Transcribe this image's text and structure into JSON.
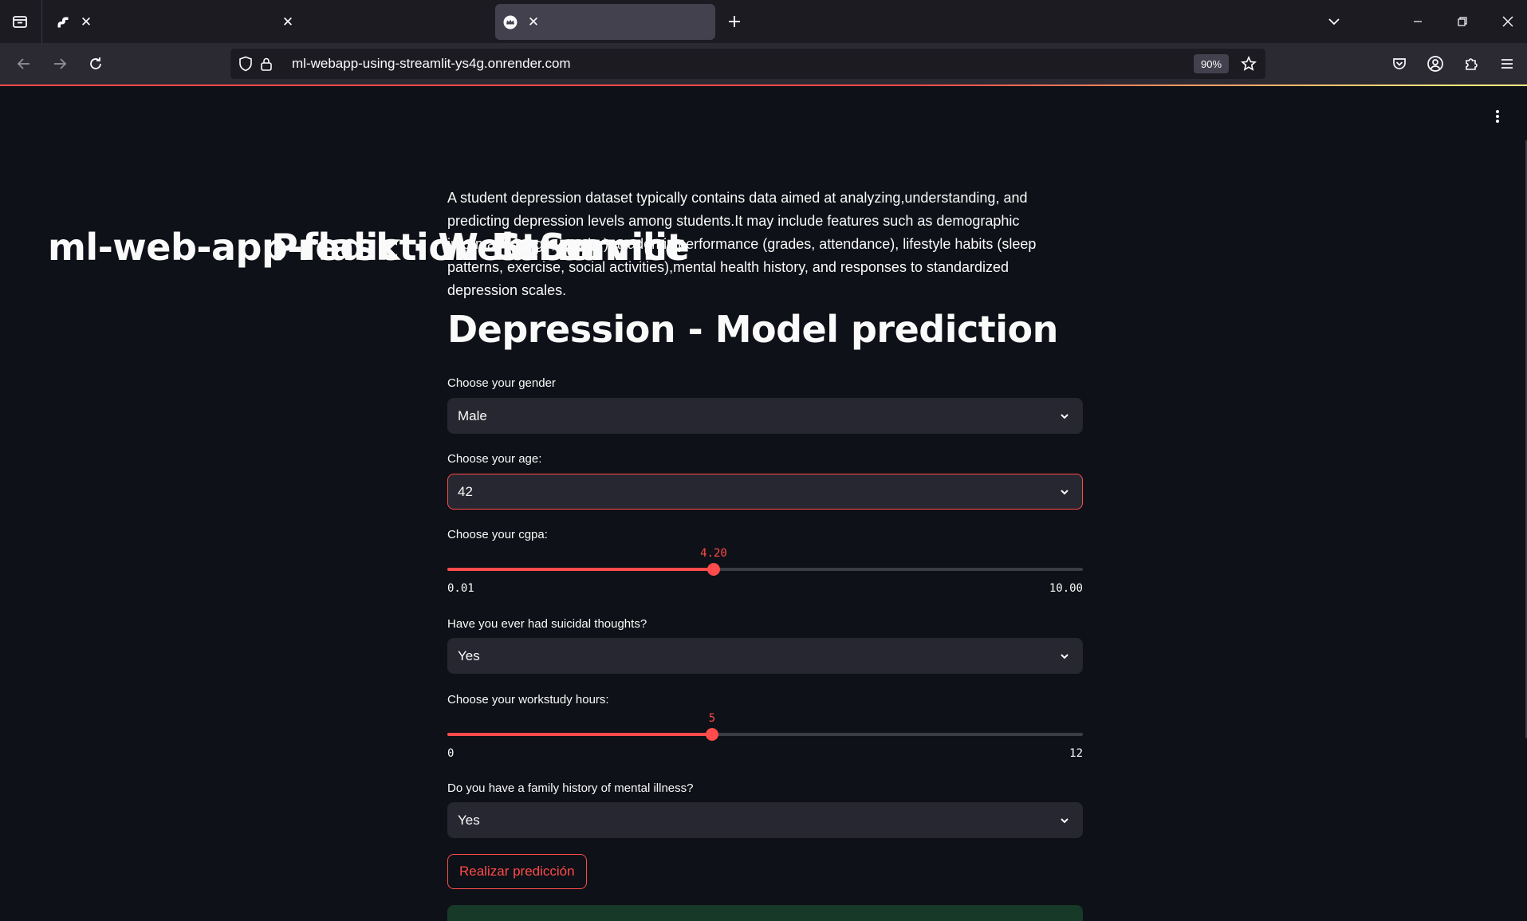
{
  "browser": {
    "tabs": [
      {
        "title": "ml-web-app-flask · Web Service",
        "active": false,
        "icon": "render-logo-icon"
      },
      {
        "title": "Prediction Form",
        "active": false,
        "icon": ""
      },
      {
        "title": "Streamlit",
        "active": true,
        "icon": "streamlit-crown-icon"
      }
    ],
    "url": "ml-webapp-using-streamlit-ys4g.onrender.com",
    "zoom": "90%"
  },
  "app": {
    "intro": "A student depression dataset typically contains data aimed at analyzing,understanding, and predicting depression levels among students.It may include features such as demographic information (age, gender),academic performance (grades, attendance), lifestyle habits (sleep patterns, exercise, social activities),mental health history, and responses to standardized depression scales.",
    "title": "Depression - Model prediction",
    "gender": {
      "label": "Choose your gender",
      "value": "Male"
    },
    "age": {
      "label": "Choose your age:",
      "value": "42"
    },
    "cgpa": {
      "label": "Choose your cgpa:",
      "value": "4.20",
      "min": "0.01",
      "max": "10.00",
      "value_num": 4.2,
      "min_num": 0.01,
      "max_num": 10.0
    },
    "suicidal": {
      "label": "Have you ever had suicidal thoughts?",
      "value": "Yes"
    },
    "workstudy": {
      "label": "Choose your workstudy hours:",
      "value": "5",
      "min": "0",
      "max": "12",
      "value_num": 5,
      "min_num": 0,
      "max_num": 12
    },
    "family": {
      "label": "Do you have a family history of mental illness?",
      "value": "Yes"
    },
    "predict_button": "Realizar predicción"
  },
  "colors": {
    "accent": "#ff4b4b",
    "background": "#0e1117",
    "widget": "#262730",
    "success": "#173928"
  }
}
